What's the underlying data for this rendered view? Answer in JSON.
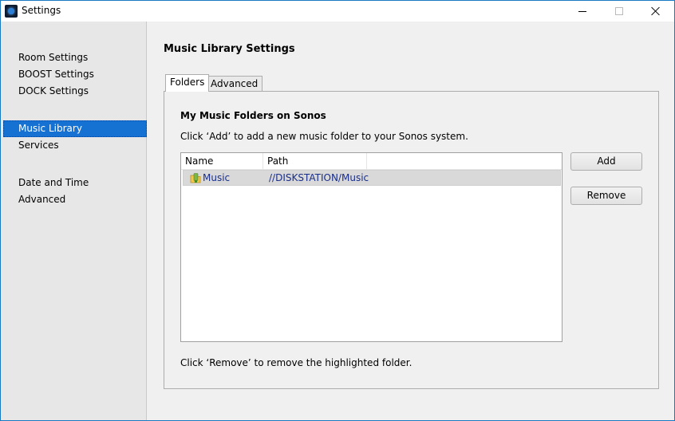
{
  "window": {
    "title": "Settings"
  },
  "sidebar": {
    "groups": [
      {
        "items": [
          {
            "label": "Room Settings"
          },
          {
            "label": "BOOST Settings"
          },
          {
            "label": "DOCK Settings"
          }
        ]
      },
      {
        "items": [
          {
            "label": "Music Library",
            "selected": true
          },
          {
            "label": "Services"
          }
        ]
      },
      {
        "items": [
          {
            "label": "Date and Time"
          },
          {
            "label": "Advanced"
          }
        ]
      }
    ]
  },
  "main": {
    "title": "Music Library Settings",
    "tabs": [
      {
        "label": "Folders",
        "active": true
      },
      {
        "label": "Advanced",
        "active": false
      }
    ],
    "section_title": "My Music Folders on Sonos",
    "instruction_add": "Click ‘Add’ to add a new music folder to your Sonos system.",
    "instruction_remove": "Click ‘Remove’ to remove the highlighted folder.",
    "table": {
      "columns": [
        "Name",
        "Path"
      ],
      "rows": [
        {
          "name": "Music",
          "path": "//DISKSTATION/Music",
          "icon": "shared-folder-icon",
          "highlighted": true
        }
      ]
    },
    "buttons": {
      "add": "Add",
      "remove": "Remove"
    }
  },
  "colors": {
    "selection": "#1572d3",
    "link_text": "#1a2e8a",
    "window_border": "#1a79c3"
  }
}
